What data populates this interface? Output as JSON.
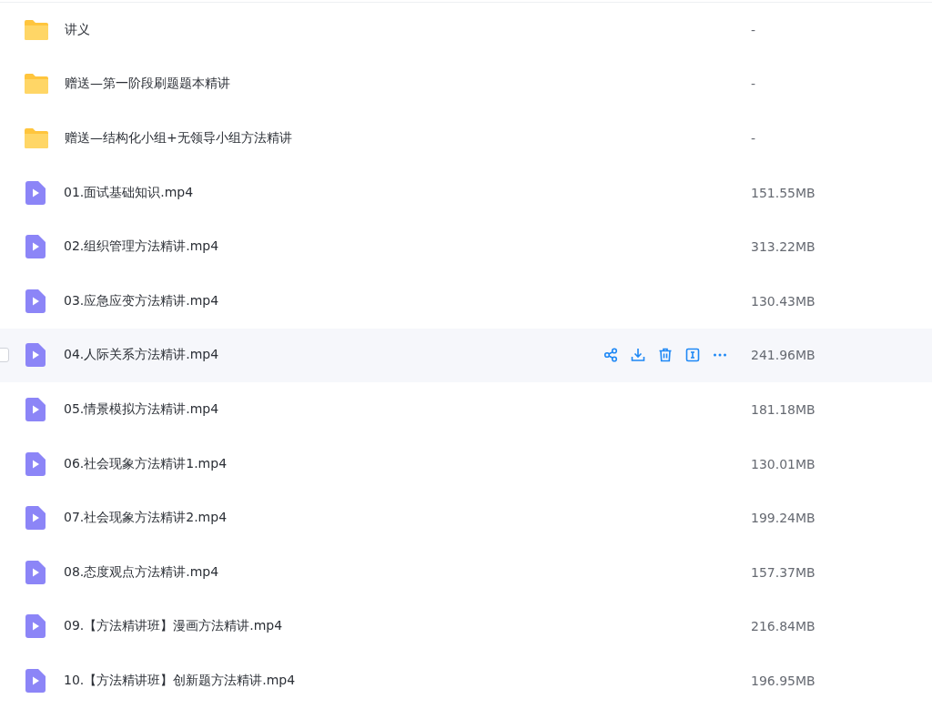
{
  "files": [
    {
      "kind": "folder",
      "name": "讲义",
      "size": "-",
      "hovered": false
    },
    {
      "kind": "folder",
      "name": "赠送—第一阶段刷题题本精讲",
      "size": "-",
      "hovered": false
    },
    {
      "kind": "folder",
      "name": "赠送—结构化小组+无领导小组方法精讲",
      "size": "-",
      "hovered": false
    },
    {
      "kind": "video",
      "name": "01.面试基础知识.mp4",
      "size": "151.55MB",
      "hovered": false
    },
    {
      "kind": "video",
      "name": "02.组织管理方法精讲.mp4",
      "size": "313.22MB",
      "hovered": false
    },
    {
      "kind": "video",
      "name": "03.应急应变方法精讲.mp4",
      "size": "130.43MB",
      "hovered": false
    },
    {
      "kind": "video",
      "name": "04.人际关系方法精讲.mp4",
      "size": "241.96MB",
      "hovered": true
    },
    {
      "kind": "video",
      "name": "05.情景模拟方法精讲.mp4",
      "size": "181.18MB",
      "hovered": false
    },
    {
      "kind": "video",
      "name": "06.社会现象方法精讲1.mp4",
      "size": "130.01MB",
      "hovered": false
    },
    {
      "kind": "video",
      "name": "07.社会现象方法精讲2.mp4",
      "size": "199.24MB",
      "hovered": false
    },
    {
      "kind": "video",
      "name": "08.态度观点方法精讲.mp4",
      "size": "157.37MB",
      "hovered": false
    },
    {
      "kind": "video",
      "name": "09.【方法精讲班】漫画方法精讲.mp4",
      "size": "216.84MB",
      "hovered": false
    },
    {
      "kind": "video",
      "name": "10.【方法精讲班】创新题方法精讲.mp4",
      "size": "196.95MB",
      "hovered": false
    }
  ]
}
